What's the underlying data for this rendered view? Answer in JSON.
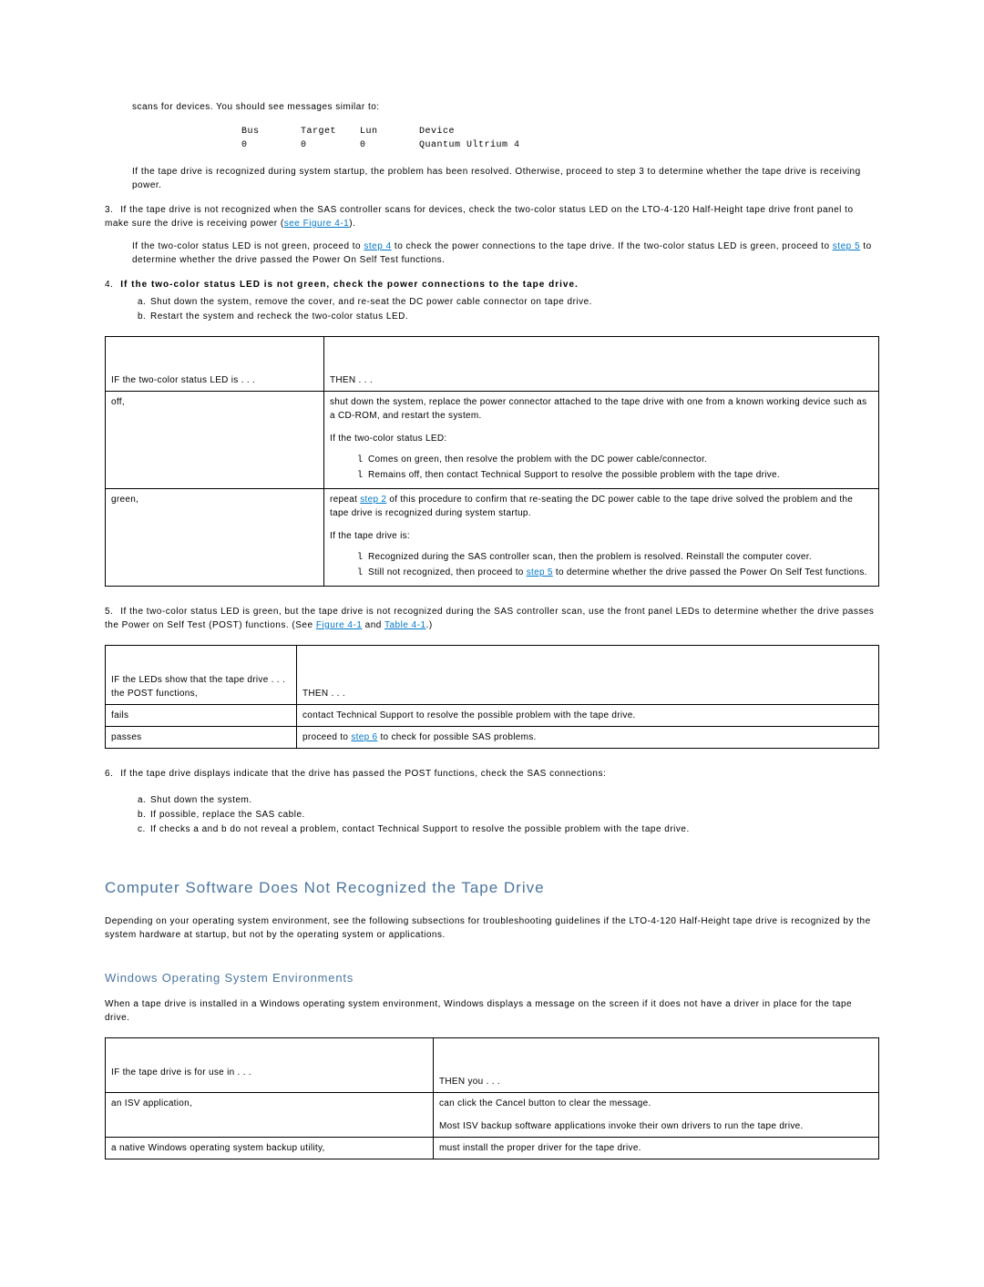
{
  "intro_line": "scans for devices. You should see messages similar to:",
  "pre_header": "Bus       Target    Lun       Device",
  "pre_row": "0         0         0         Quantum Ultrium 4",
  "after_pre": "If the tape drive is recognized during system startup, the problem has been resolved. Otherwise, proceed to step 3 to determine whether the tape drive is receiving power.",
  "steps": {
    "s3": {
      "text_a": "If the tape drive is not recognized when the SAS controller scans for devices, check the two-color status LED on the LTO-4-120 Half-Height tape drive front panel to make sure the drive is receiving power (",
      "link1": "see Figure 4-1",
      "text_b": ").",
      "p2_a": "If the two-color status LED is not green, proceed to ",
      "p2_link1": "step 4",
      "p2_b": " to check the power connections to the tape drive. If the two-color status LED is green, proceed to ",
      "p2_link2": "step 5",
      "p2_c": " to determine whether the drive passed the Power On Self Test functions."
    },
    "s4": {
      "text": "If the two-color status LED is not green, check the power connections to the tape drive.",
      "sub_a": "Shut down the system, remove the cover, and re-seat the DC power cable connector on tape drive.",
      "sub_b": "Restart the system and recheck the two-color status LED."
    },
    "s5": {
      "text_a": "If the two-color status LED is green, but the tape drive is not recognized during the SAS controller scan, use the front panel LEDs to determine whether the drive passes the Power on Self Test (POST) functions. (See ",
      "link1": "Figure 4-1",
      "text_b": " and ",
      "link2": "Table 4-1",
      "text_c": ".)"
    },
    "s6": {
      "text": "If the tape drive displays indicate that the drive has passed the POST functions, check the SAS connections:",
      "sub_a": "Shut down the system.",
      "sub_b": "If possible, replace the SAS cable.",
      "sub_c": "If checks a and b do not reveal a problem, contact Technical Support to resolve the possible problem with the tape drive."
    }
  },
  "table1": {
    "h1": "IF the two-color status LED is . . .",
    "h2": "THEN . . .",
    "r1c1": "off,",
    "r1c2": {
      "p1": "shut down the system, replace the power connector attached to the tape drive with one from a known working device such as a CD-ROM, and restart the system.",
      "p2": "If the two-color status LED:",
      "b1": "Comes on green, then resolve the problem with the DC power cable/connector.",
      "b2": "Remains off, then contact Technical Support to resolve the possible problem with the tape drive."
    },
    "r2c1": "green,",
    "r2c2": {
      "p1_a": "repeat ",
      "p1_link": "step 2",
      "p1_b": " of this procedure to confirm that re-seating the DC power cable to the tape drive solved the problem and the tape drive is recognized during system startup.",
      "p2": "If the tape drive is:",
      "b1": "Recognized during the SAS controller scan, then the problem is resolved. Reinstall the computer cover.",
      "b2_a": "Still not recognized, then proceed to ",
      "b2_link": "step 5",
      "b2_b": " to determine whether the drive passed the Power On Self Test functions."
    }
  },
  "table2": {
    "h1": "IF the LEDs show that the tape drive . . . the POST functions,",
    "h2": "THEN . . .",
    "r1c1": "fails",
    "r1c2": "contact Technical Support to resolve the possible problem with the tape drive.",
    "r2c1": "passes",
    "r2c2_a": "proceed to ",
    "r2c2_link": "step 6",
    "r2c2_b": " to check for possible SAS problems."
  },
  "h2_title": "Computer Software Does Not Recognized the Tape Drive",
  "h2_para": "Depending on your operating system environment, see the following subsections for troubleshooting guidelines if the LTO-4-120 Half-Height tape drive is recognized by the system hardware at startup, but not by the operating system or applications.",
  "h3_title": "Windows Operating System Environments",
  "h3_para": "When a tape drive is installed in a Windows operating system environment, Windows displays a message on the screen if it does not have a driver in place for the tape drive.",
  "table3": {
    "h1": "IF the tape drive is for use in . . .",
    "h2": "THEN you . . .",
    "r1c1": "an ISV application,",
    "r1c2_p1": "can click the Cancel button to clear the message.",
    "r1c2_p2": "Most ISV backup software applications invoke their own drivers to run the tape drive.",
    "r2c1": "a native Windows operating system backup utility,",
    "r2c2": "must install the proper driver for the tape drive."
  }
}
